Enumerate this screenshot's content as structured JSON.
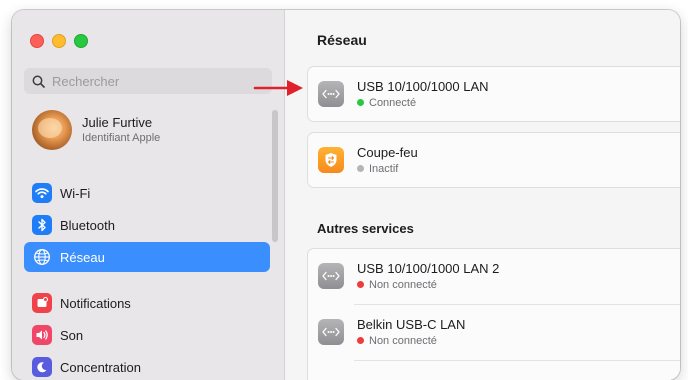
{
  "window": {
    "traffic_lights": [
      "close",
      "minimize",
      "zoom"
    ]
  },
  "sidebar": {
    "search": {
      "placeholder": "Rechercher",
      "value": ""
    },
    "account": {
      "name": "Julie Furtive",
      "subtitle": "Identifiant Apple"
    },
    "items": [
      {
        "label": "Wi-Fi",
        "icon": "wifi-icon",
        "selected": false
      },
      {
        "label": "Bluetooth",
        "icon": "bluetooth-icon",
        "selected": false
      },
      {
        "label": "Réseau",
        "icon": "globe-icon",
        "selected": true
      },
      {
        "label": "Notifications",
        "icon": "bell-icon",
        "selected": false
      },
      {
        "label": "Son",
        "icon": "speaker-icon",
        "selected": false
      },
      {
        "label": "Concentration",
        "icon": "moon-icon",
        "selected": false
      }
    ]
  },
  "main": {
    "title": "Réseau",
    "services": [
      {
        "name": "USB 10/100/1000 LAN",
        "status": "Connecté",
        "status_color": "#28c840",
        "icon": "ethernet-icon"
      }
    ],
    "firewall": {
      "name": "Coupe-feu",
      "status": "Inactif",
      "status_color": "#b5b5b7",
      "icon": "firewall-icon"
    },
    "other_title": "Autres services",
    "other_services": [
      {
        "name": "USB 10/100/1000 LAN 2",
        "status": "Non connecté",
        "status_color": "#ee3b3b",
        "icon": "ethernet-icon"
      },
      {
        "name": "Belkin USB-C LAN",
        "status": "Non connecté",
        "status_color": "#ee3b3b",
        "icon": "ethernet-icon"
      }
    ]
  },
  "annotation": {
    "arrow_color": "#e0202a",
    "icon": "red-arrow-icon"
  }
}
